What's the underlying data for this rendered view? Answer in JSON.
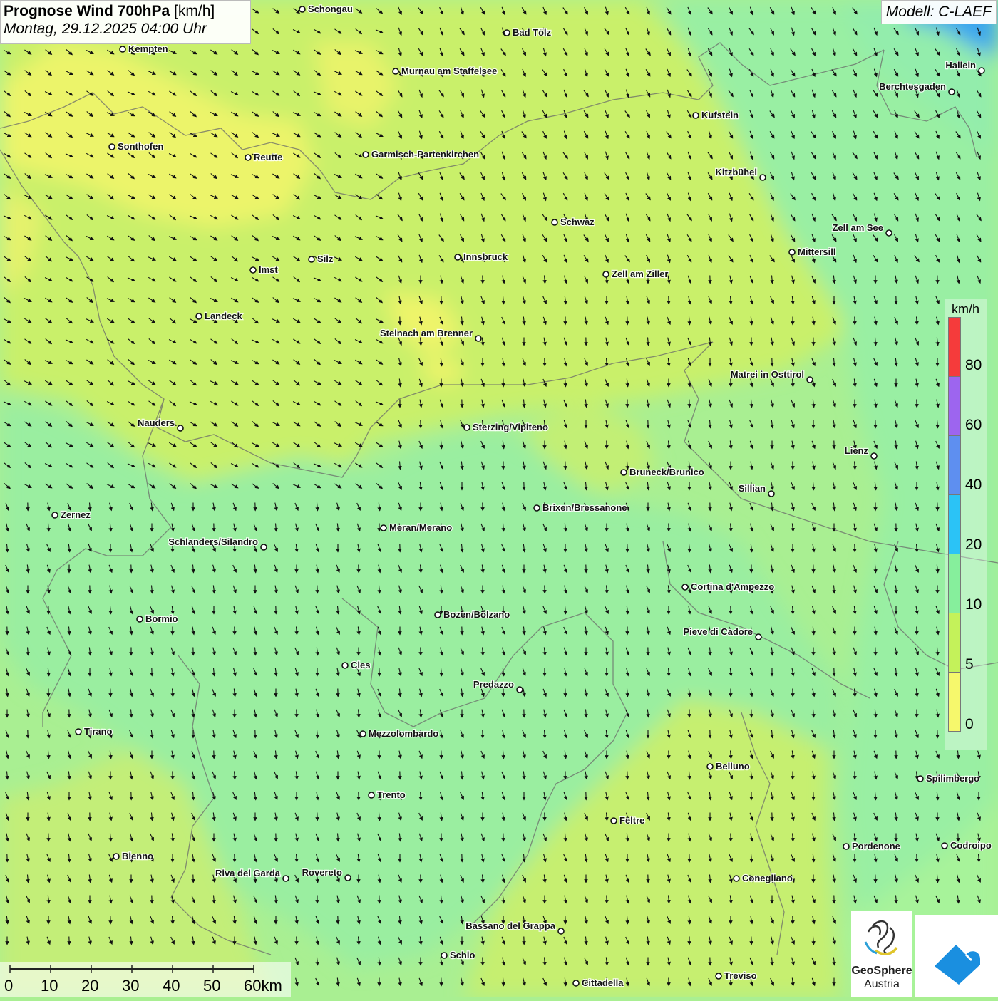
{
  "header": {
    "title_bold": "Prognose Wind 700hPa",
    "title_unit": "[km/h]",
    "date": "Montag, 29.12.2025 04:00 Uhr"
  },
  "model_label": "Modell: C-LAEF",
  "legend": {
    "unit": "km/h",
    "segments": [
      {
        "color": "#f53b3b",
        "label": "80"
      },
      {
        "color": "#9d65ef",
        "label": "60"
      },
      {
        "color": "#5e8ff0",
        "label": "40"
      },
      {
        "color": "#2bc3f6",
        "label": "20"
      },
      {
        "color": "#86ef9c",
        "label": "10"
      },
      {
        "color": "#c4f25a",
        "label": "5"
      },
      {
        "color": "#f6f86c",
        "label": "0"
      }
    ]
  },
  "scale_bar": {
    "labels": [
      "0",
      "10",
      "20",
      "30",
      "40",
      "50",
      "60km"
    ]
  },
  "logo": {
    "line1": "GeoSphere",
    "line2": "Austria"
  },
  "cities": [
    {
      "name": "Schongau",
      "side": "right"
    },
    {
      "name": "Bad Tölz",
      "side": "right"
    },
    {
      "name": "Kempten",
      "side": "right"
    },
    {
      "name": "Murnau am Staffelsee",
      "side": "right"
    },
    {
      "name": "Hallein",
      "side": "left"
    },
    {
      "name": "Berchtesgaden",
      "side": "left"
    },
    {
      "name": "Kufstein",
      "side": "right"
    },
    {
      "name": "Sonthofen",
      "side": "right"
    },
    {
      "name": "Reutte",
      "side": "right"
    },
    {
      "name": "Garmisch-Partenkirchen",
      "side": "right"
    },
    {
      "name": "Kitzbühel",
      "side": "left"
    },
    {
      "name": "Schwaz",
      "side": "right"
    },
    {
      "name": "Zell am See",
      "side": "left"
    },
    {
      "name": "Mittersill",
      "side": "right"
    },
    {
      "name": "Innsbruck",
      "side": "right"
    },
    {
      "name": "Imst",
      "side": "right"
    },
    {
      "name": "Silz",
      "side": "right"
    },
    {
      "name": "Zell am Ziller",
      "side": "right"
    },
    {
      "name": "Landeck",
      "side": "right"
    },
    {
      "name": "Steinach am Brenner",
      "side": "left"
    },
    {
      "name": "Matrei in Osttirol",
      "side": "left"
    },
    {
      "name": "Nauders",
      "side": "left"
    },
    {
      "name": "Sterzing/Vipiteno",
      "side": "right"
    },
    {
      "name": "Lienz",
      "side": "left"
    },
    {
      "name": "Bruneck/Brunico",
      "side": "right"
    },
    {
      "name": "Sillian",
      "side": "left"
    },
    {
      "name": "Brixen/Bressanone",
      "side": "right"
    },
    {
      "name": "Zernez",
      "side": "right"
    },
    {
      "name": "Meran/Merano",
      "side": "right"
    },
    {
      "name": "Schlanders/Silandro",
      "side": "left"
    },
    {
      "name": "Cortina d'Ampezzo",
      "side": "right"
    },
    {
      "name": "Bozen/Bolzano",
      "side": "right"
    },
    {
      "name": "Bormio",
      "side": "right"
    },
    {
      "name": "Pieve di Cadore",
      "side": "left"
    },
    {
      "name": "Cles",
      "side": "right"
    },
    {
      "name": "Predazzo",
      "side": "left"
    },
    {
      "name": "Tirano",
      "side": "right"
    },
    {
      "name": "Mezzolombardo",
      "side": "right"
    },
    {
      "name": "Belluno",
      "side": "right"
    },
    {
      "name": "Spilimbergo",
      "side": "right"
    },
    {
      "name": "Trento",
      "side": "right"
    },
    {
      "name": "Feltre",
      "side": "right"
    },
    {
      "name": "Pordenone",
      "side": "right"
    },
    {
      "name": "Codroipo",
      "side": "right"
    },
    {
      "name": "Bienno",
      "side": "right"
    },
    {
      "name": "Riva del Garda",
      "side": "left"
    },
    {
      "name": "Rovereto",
      "side": "left"
    },
    {
      "name": "Conegliano",
      "side": "right"
    },
    {
      "name": "Bassano del Grappa",
      "side": "left"
    },
    {
      "name": "Schio",
      "side": "right"
    },
    {
      "name": "Treviso",
      "side": "right"
    },
    {
      "name": "Cittadella",
      "side": "right"
    }
  ]
}
